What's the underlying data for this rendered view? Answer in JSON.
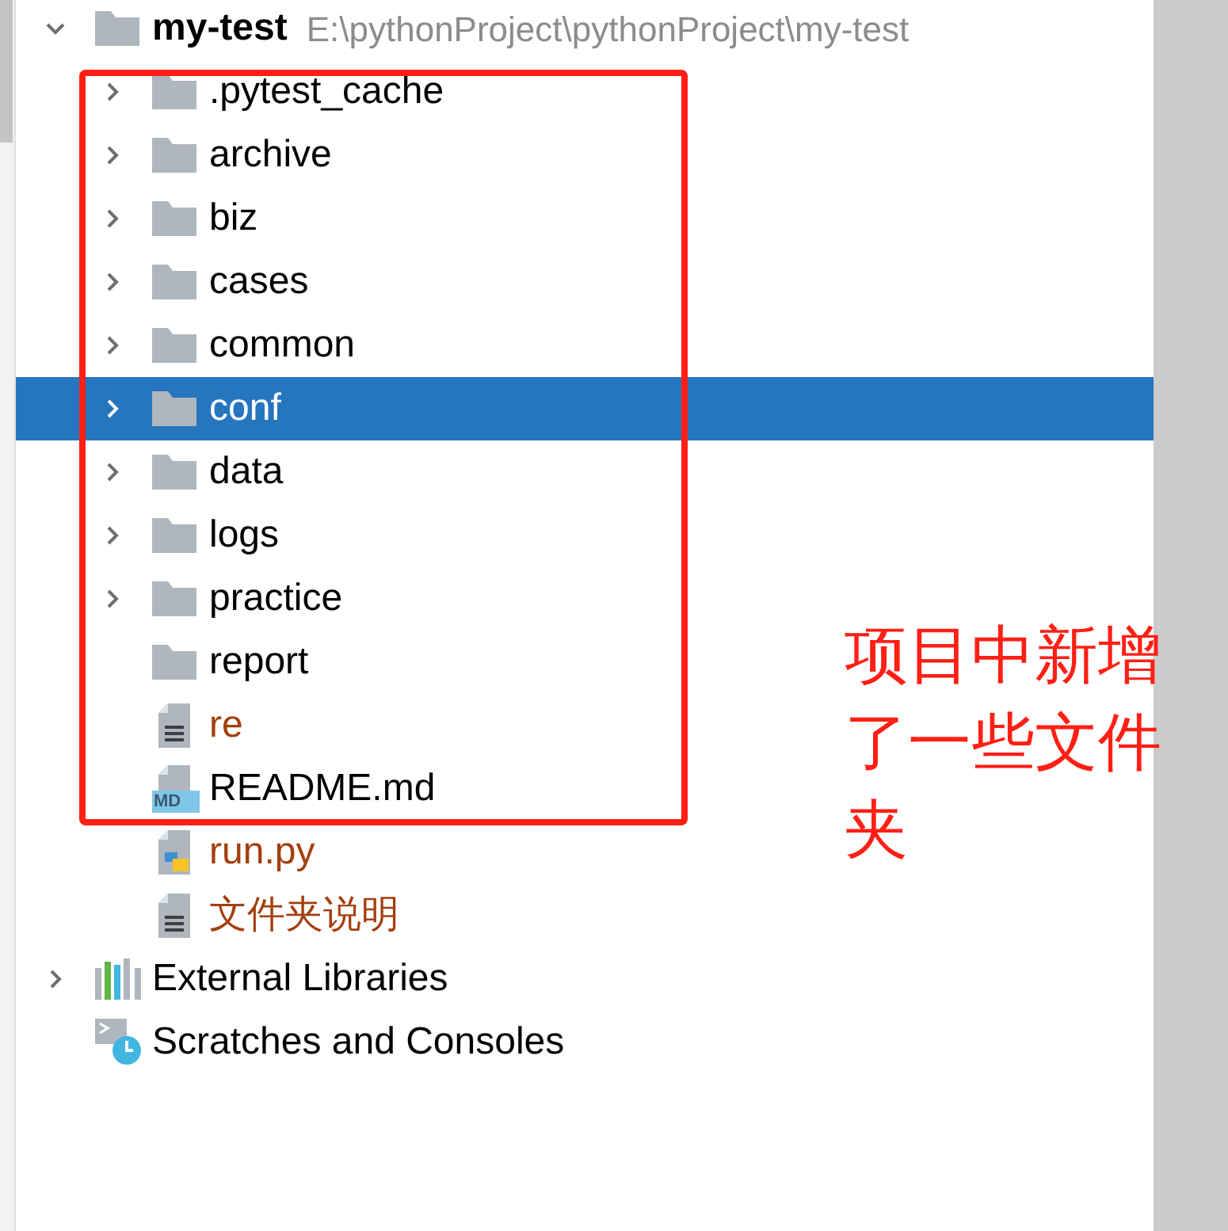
{
  "tree": [
    {
      "name": "my-test",
      "path": "E:\\pythonProject\\pythonProject\\my-test",
      "kind": "folder",
      "expanded": true,
      "selected": false,
      "color": "#000000",
      "children": [
        {
          "name": ".pytest_cache",
          "kind": "folder",
          "expanded": false,
          "selected": false,
          "color": "#000000"
        },
        {
          "name": "archive",
          "kind": "folder",
          "expanded": false,
          "selected": false,
          "color": "#000000"
        },
        {
          "name": "biz",
          "kind": "folder",
          "expanded": false,
          "selected": false,
          "color": "#000000"
        },
        {
          "name": "cases",
          "kind": "folder",
          "expanded": false,
          "selected": false,
          "color": "#000000"
        },
        {
          "name": "common",
          "kind": "folder",
          "expanded": false,
          "selected": false,
          "color": "#000000"
        },
        {
          "name": "conf",
          "kind": "folder",
          "expanded": false,
          "selected": true
        },
        {
          "name": "data",
          "kind": "folder",
          "expanded": false,
          "selected": false,
          "color": "#000000"
        },
        {
          "name": "logs",
          "kind": "folder",
          "expanded": false,
          "selected": false,
          "color": "#000000"
        },
        {
          "name": "practice",
          "kind": "folder",
          "expanded": false,
          "selected": false,
          "color": "#000000"
        },
        {
          "name": "report",
          "kind": "folder",
          "selected": false,
          "color": "#000000"
        },
        {
          "name": "re",
          "kind": "text",
          "selected": false,
          "color": "#a2400e"
        },
        {
          "name": "README.md",
          "kind": "markdown",
          "badge": "MD",
          "selected": false,
          "color": "#000000"
        },
        {
          "name": "run.py",
          "kind": "python",
          "selected": false,
          "color": "#a2400e"
        },
        {
          "name": "文件夹说明",
          "kind": "text",
          "selected": false,
          "color": "#a2400e"
        }
      ]
    },
    {
      "name": "External Libraries",
      "kind": "libraries",
      "expanded": false,
      "selected": false,
      "color": "#000000"
    },
    {
      "name": "Scratches and Consoles",
      "kind": "scratches",
      "selected": false,
      "color": "#000000"
    }
  ],
  "annotation": {
    "text": "项目中新增了一些文件夹"
  }
}
